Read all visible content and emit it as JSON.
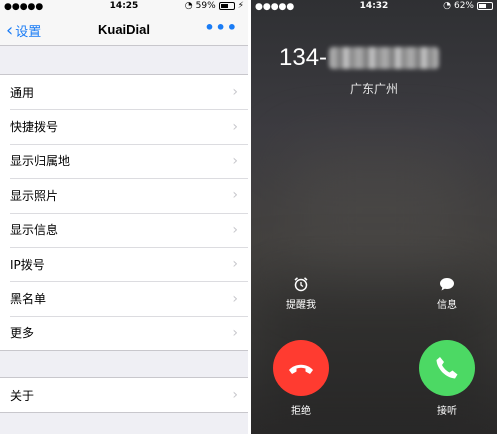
{
  "left": {
    "status": {
      "carrier": "●●●●●",
      "time": "14:25",
      "battery": "59%",
      "battery_level": 0.59
    },
    "nav": {
      "back_label": "设置",
      "title": "KuaiDial",
      "more": "•••"
    },
    "group1": [
      {
        "label": "通用"
      },
      {
        "label": "快捷拨号"
      },
      {
        "label": "显示归属地"
      },
      {
        "label": "显示照片"
      },
      {
        "label": "显示信息"
      },
      {
        "label": "IP拨号"
      },
      {
        "label": "黑名单"
      },
      {
        "label": "更多"
      }
    ],
    "group2": [
      {
        "label": "关于"
      }
    ]
  },
  "right": {
    "status": {
      "carrier": "●●●●●",
      "time": "14:32",
      "battery": "62%",
      "battery_level": 0.62
    },
    "number_prefix": "134-",
    "location": "广东广州",
    "remind_label": "提醒我",
    "message_label": "信息",
    "decline_label": "拒绝",
    "accept_label": "接听"
  },
  "colors": {
    "accent": "#1a7cf5",
    "decline": "#ff3b30",
    "accept": "#4cd964"
  }
}
